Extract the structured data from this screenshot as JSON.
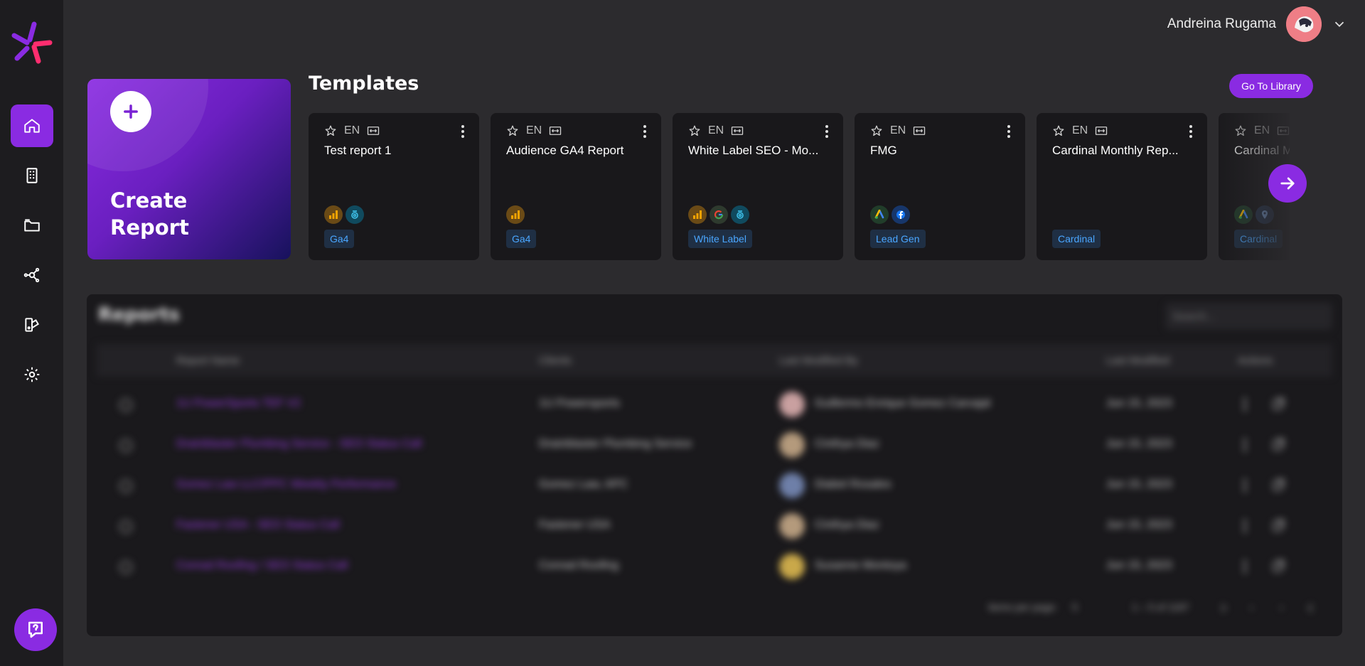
{
  "user": {
    "name": "Andreina Rugama"
  },
  "sidebar": {
    "items": [
      {
        "icon": "home-icon",
        "active": true
      },
      {
        "icon": "building-icon",
        "active": false
      },
      {
        "icon": "folder-icon",
        "active": false
      },
      {
        "icon": "integrations-icon",
        "active": false
      },
      {
        "icon": "branding-icon",
        "active": false
      },
      {
        "icon": "gear-icon",
        "active": false
      }
    ],
    "help_icon": "help-chat-icon"
  },
  "create": {
    "label": "Create Report"
  },
  "templates": {
    "title": "Templates",
    "library_label": "Go To Library",
    "cards": [
      {
        "lang": "EN",
        "title": "Test report 1",
        "tag": "Ga4",
        "sources": [
          "ga",
          "an"
        ]
      },
      {
        "lang": "EN",
        "title": "Audience GA4 Report",
        "tag": "Ga4",
        "sources": [
          "ga"
        ]
      },
      {
        "lang": "EN",
        "title": "White Label SEO - Mo...",
        "tag": "White Label",
        "sources": [
          "ga",
          "go",
          "an"
        ]
      },
      {
        "lang": "EN",
        "title": "FMG",
        "tag": "Lead Gen",
        "sources": [
          "ads",
          "fb"
        ]
      },
      {
        "lang": "EN",
        "title": "Cardinal Monthly Rep...",
        "tag": "Cardinal",
        "sources": []
      },
      {
        "lang": "EN",
        "title": "Cardinal M",
        "tag": "Cardinal",
        "sources": [
          "ads",
          "map"
        ]
      }
    ]
  },
  "reports": {
    "title": "Reports",
    "search_placeholder": "Search...",
    "columns": [
      "Report Name",
      "Clients",
      "Last Modified By",
      "Last Modified",
      "Actions"
    ],
    "rows": [
      {
        "name": "1U PowerSports TEF V2",
        "client": "1U Powersports",
        "modified_by": "Guillermo Enrique Gomez Carvajal",
        "date": "Jun 15, 2023"
      },
      {
        "name": "Drainblaster Plumbing Service - SEO Status Call",
        "client": "Drainblaster Plumbing Service",
        "modified_by": "Cinthya Diaz",
        "date": "Jun 15, 2023"
      },
      {
        "name": "Gomez Law LLC/PPC Weekly Performance",
        "client": "Gomez Law, APC",
        "modified_by": "Diabel Rosales",
        "date": "Jun 15, 2023"
      },
      {
        "name": "Fastener USA - SEO Status Call",
        "client": "Fastener USA",
        "modified_by": "Cinthya Diaz",
        "date": "Jun 15, 2023"
      },
      {
        "name": "Conrad Roofing / SEO Status Call",
        "client": "Conrad Roofing",
        "modified_by": "Susanne Montoya",
        "date": "Jun 15, 2023"
      }
    ],
    "pager": {
      "items_per_page": "Items per page:",
      "page_size": "5",
      "range": "1 – 5 of 1187"
    }
  }
}
